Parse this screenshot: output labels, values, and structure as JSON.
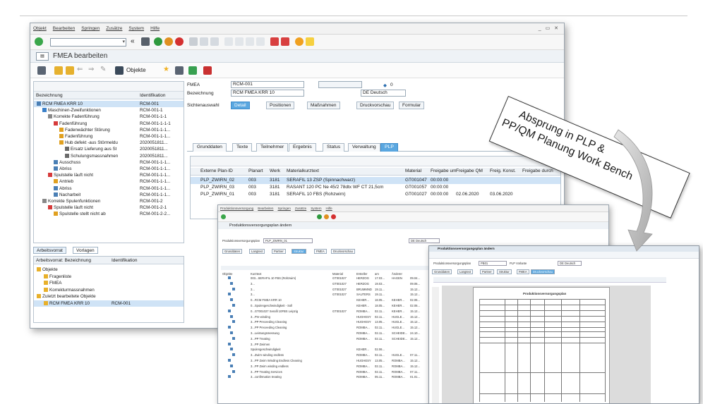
{
  "main_window": {
    "menu": [
      "Objekt",
      "Bearbeiten",
      "Springen",
      "Zusätze",
      "System",
      "Hilfe"
    ],
    "window_controls": "_ ▭ ✕",
    "title": "FMEA bearbeiten",
    "objekte_button": "Objekte",
    "tree": {
      "col_bezeichnung": "Bezeichnung",
      "col_identifikation": "Identifikation",
      "rows": [
        {
          "indent": 0,
          "label": "RCM FMEA KRR 10",
          "id": "RCM-001",
          "color": "#4a7fb5",
          "selected": true
        },
        {
          "indent": 1,
          "label": "Maschinen-Zweifunktionen",
          "id": "RCM-001-1",
          "color": "#3b80c8"
        },
        {
          "indent": 2,
          "label": "Korrekte Fadenführung",
          "id": "RCM-001-1-1",
          "color": "#888888"
        },
        {
          "indent": 3,
          "label": "Fadenführung",
          "id": "RCM-001-1-1-1",
          "color": "#d63a3a"
        },
        {
          "indent": 4,
          "label": "Fadenwächter Störung",
          "id": "RCM-001-1-1...",
          "color": "#e0a020"
        },
        {
          "indent": 4,
          "label": "Fadenführung",
          "id": "RCM-001-1-1...",
          "color": "#e0a020"
        },
        {
          "indent": 4,
          "label": "Hub defekt -aus Störmeldu",
          "id": "2020051811...",
          "color": "#e0a020"
        },
        {
          "indent": 5,
          "label": "Ersatz Lieferung aus St",
          "id": "2020051811...",
          "color": "#6a6a6a"
        },
        {
          "indent": 5,
          "label": "Schulungsmassnahmen",
          "id": "2020051811...",
          "color": "#6a6a6a"
        },
        {
          "indent": 3,
          "label": "Ausschuss",
          "id": "RCM-001-1-1...",
          "color": "#4a7fb5"
        },
        {
          "indent": 3,
          "label": "Abriss",
          "id": "RCM-001-1-1...",
          "color": "#4a7fb5"
        },
        {
          "indent": 2,
          "label": "Spulstelle läuft nicht",
          "id": "RCM-001-1-1...",
          "color": "#d63a3a"
        },
        {
          "indent": 3,
          "label": "Antrieb",
          "id": "RCM-001-1-1...",
          "color": "#e0a020"
        },
        {
          "indent": 3,
          "label": "Abriss",
          "id": "RCM-001-1-1...",
          "color": "#4a7fb5"
        },
        {
          "indent": 3,
          "label": "Nacharbeit",
          "id": "RCM-001-1-1...",
          "color": "#4a7fb5"
        },
        {
          "indent": 1,
          "label": "Korrekte Spulenfunktionen",
          "id": "RCM-001-2",
          "color": "#888888"
        },
        {
          "indent": 2,
          "label": "Spulstelle läuft nicht",
          "id": "RCM-001-2-1",
          "color": "#d63a3a"
        },
        {
          "indent": 3,
          "label": "Spulstelle stellt nicht ab",
          "id": "RCM-001-2-2...",
          "color": "#e0a020"
        }
      ]
    },
    "bottom_tabs": {
      "arbeitsvorrat": "Arbeitsvorrat",
      "vorlagen": "Vorlagen"
    },
    "arbeitsvorrat": {
      "col_bezeichnung": "Arbeitsvorrat: Bezeichnung",
      "col_identifikation": "Identifikation",
      "rows": [
        {
          "indent": 0,
          "label": "Objekte",
          "id": ""
        },
        {
          "indent": 1,
          "label": "Fragenliste",
          "id": ""
        },
        {
          "indent": 1,
          "label": "FMEA",
          "id": ""
        },
        {
          "indent": 1,
          "label": "Korrekturmassnahmen",
          "id": ""
        },
        {
          "indent": 0,
          "label": "Zuletzt bearbeitete Objekte",
          "id": ""
        },
        {
          "indent": 1,
          "label": "RCM FMEA KRR 10",
          "id": "RCM-001",
          "selected": true
        }
      ]
    },
    "form": {
      "fmea_label": "FMEA",
      "fmea_value": "RCM-001",
      "bezeichnung_label": "Bezeichnung",
      "bezeichnung_value": "RCM FMEA KRR 10",
      "language": "DE Deutsch",
      "counter": "0",
      "sichtenauswahl_label": "Sichtenauswahl",
      "view_buttons": [
        "Detail",
        "Positionen",
        "Maßnahmen",
        "Druckvorschau",
        "Formular"
      ],
      "tabs": [
        "Grunddaten",
        "Texte",
        "Teilnehmer",
        "Ergebnis",
        "Status",
        "Verwaltung",
        "PLP"
      ],
      "plp_table": {
        "headers": [
          "Externe Plan-ID",
          "Planart",
          "Werk",
          "Materialkurztext",
          "Material",
          "Freigabe um",
          "Freigabe QM",
          "Freig. Konst.",
          "Freigabe durch"
        ],
        "rows": [
          [
            "PLP_ZWIRN_02",
            "003",
            "3181",
            "SERAFIL 13 ZSP (Spinnachwarz)",
            "GT001047",
            "00:00:00",
            "",
            "",
            ""
          ],
          [
            "PLP_ZWIRN_03",
            "003",
            "3181",
            "RASANT 120 PC Ne 45/2 78dtx WF CT 21,5cm",
            "GT001057",
            "00:00:00",
            "",
            "",
            ""
          ],
          [
            "PLP_ZWIRN_01",
            "003",
            "3181",
            "SERAFIL 10 FBS (Rohzwirn)",
            "GT001027",
            "00:00:00",
            "02.06.2020",
            "03.06.2020",
            ""
          ]
        ]
      }
    }
  },
  "window2": {
    "menu": [
      "Produktionsversorgung",
      "Bearbeiten",
      "Springen",
      "Zusätze",
      "System",
      "Hilfe"
    ],
    "title": "Produktionsversorgungsplan ändern",
    "field_label": "Produktionsversorgungsplan",
    "field_value": "PLP_ZWIRN_01",
    "language": "DE Deutsch",
    "tabs": [
      "Grunddaten",
      "Langtext",
      "Partner",
      "Struktur",
      "FMEA",
      "Druckvorschau"
    ],
    "col_objekte": "Objekte",
    "col_kurztext": "Kurztext",
    "col_material": "Material",
    "col_ersteller": "Ersteller",
    "col_am": "am",
    "col_aenderer": "Änderer",
    "rows": [
      [
        "003...SERAFIL 10 FBS (Rohzwirn)",
        "GT001027",
        "HERZOG",
        "17.03...",
        "HAGEN",
        "09.04..."
      ],
      [
        "3...",
        "GT001027",
        "HERZOG",
        "19.03...",
        "",
        "09.06..."
      ],
      [
        "3...",
        "GT001027",
        "BRUMMND",
        "19.11...",
        "",
        "15.12..."
      ],
      [
        "3...",
        "GT001027",
        "SAUTERS",
        "19.11...",
        "",
        "15.12..."
      ],
      [
        "0...RCM FMEA KRR 10",
        "",
        "KEHER...",
        "18.05...",
        "KEHER...",
        "02.06..."
      ],
      [
        "0...Spulengeschwindigkeit - Soll",
        "",
        "KEHER...",
        "18.05...",
        "KEHER...",
        "02.06..."
      ],
      [
        "0...GT001027 Serafil 10FBS Leipzig",
        "GT001027",
        "ROMBA...",
        "02.11...",
        "KEHER...",
        "15.12..."
      ],
      [
        "3...Pre-winding",
        "",
        "HUGHESY",
        "02.11...",
        "HUGLE...",
        "15.12..."
      ],
      [
        "3...PP Preceeding Cleaning",
        "",
        "HUGHESY",
        "13.05...",
        "HUGLE...",
        "15.12..."
      ],
      [
        "3...PP Preceeding Cleaning",
        "",
        "ROMBA...",
        "02.11...",
        "HUGLE...",
        "15.12..."
      ],
      [
        "3...Leistungsmessung",
        "",
        "ROMBA...",
        "02.11...",
        "SCHEIDE...",
        "24.10..."
      ],
      [
        "3...PP Treating",
        "",
        "ROMBA...",
        "02.11...",
        "SCHEIDE...",
        "15.12..."
      ],
      [
        "3...PP Zwirnen",
        "",
        "",
        "",
        "",
        ""
      ],
      [
        "Spulengeschwindigkeit",
        "",
        "KEHER...",
        "02.06...",
        "",
        ""
      ],
      [
        "3...Zwirn winding endless",
        "",
        "ROMBA...",
        "02.11...",
        "HUGLE...",
        "07.11..."
      ],
      [
        "3...PP Zwirn Winding Endless Cleaning",
        "",
        "HUGHESY",
        "13.05...",
        "ROMBA...",
        "15.12..."
      ],
      [
        "3...PP Zwirn winding endless",
        "",
        "ROMBA...",
        "02.11...",
        "ROMBA...",
        "15.12..."
      ],
      [
        "3...PP Treating Services",
        "",
        "ROMBA...",
        "02.11...",
        "ROMBA...",
        "07.11..."
      ],
      [
        "3...confirmation treating",
        "",
        "ROMBA...",
        "05.11...",
        "ROMBA...",
        "01.01..."
      ]
    ]
  },
  "window3": {
    "title": "Produktionsversorgungsplan ändern",
    "field_label": "Produktionsversorgungsplan",
    "field_value": "PB01",
    "field2": "PLP Vorlante",
    "language": "DE Deutsch",
    "tabs": [
      "Grunddaten",
      "Langtext",
      "Partner",
      "Struktur",
      "FMEA",
      "Druckvorschau"
    ],
    "doc_title": "Produktionsversorgungsplan"
  },
  "callout": {
    "line1": "Absprung in  PLP &",
    "line2": "PP/QM Planung Work Bench"
  }
}
